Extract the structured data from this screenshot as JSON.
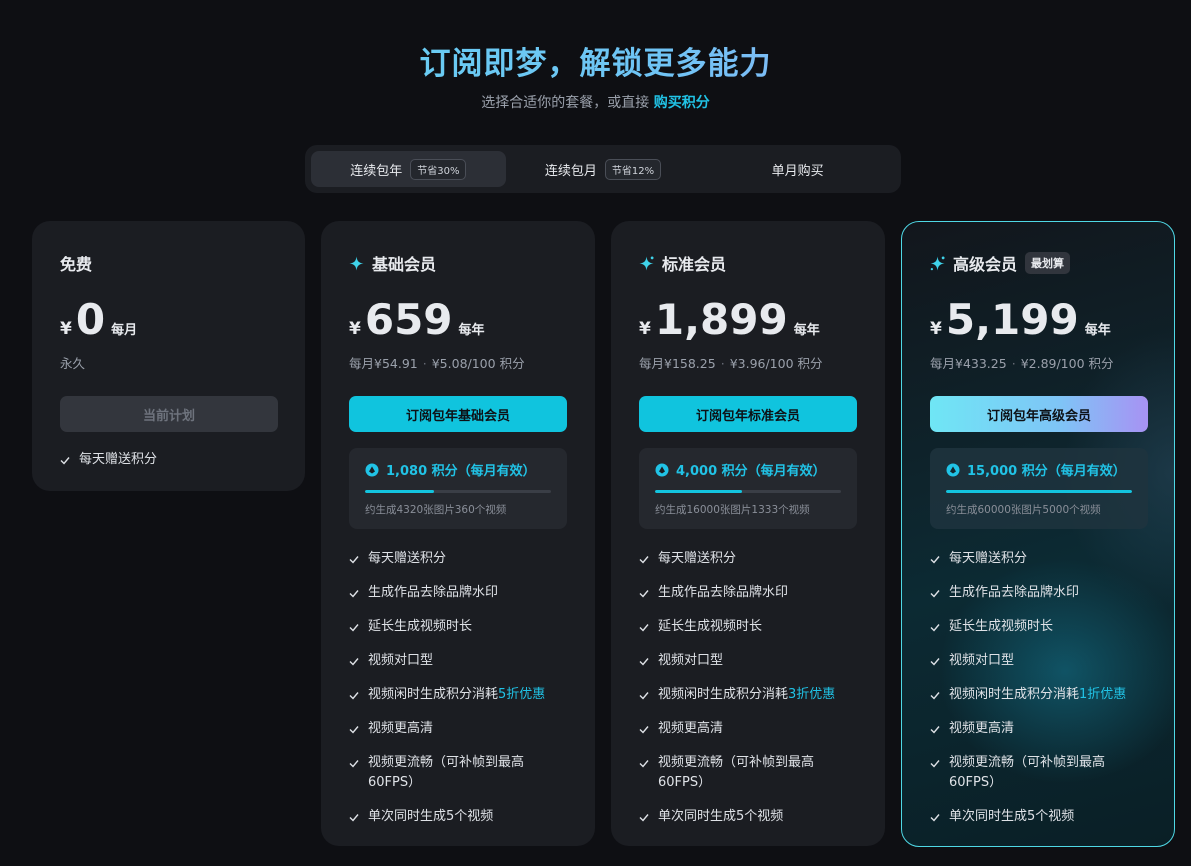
{
  "header": {
    "title": "订阅即梦，解锁更多能力",
    "subtitle_prefix": "选择合适你的套餐，或直接",
    "subtitle_link": "购买积分"
  },
  "tabs": [
    {
      "label": "连续包年",
      "badge": "节省30%",
      "active": true
    },
    {
      "label": "连续包月",
      "badge": "节省12%",
      "active": false
    },
    {
      "label": "单月购买",
      "badge": "",
      "active": false
    }
  ],
  "plans": {
    "free": {
      "name": "免费",
      "currency": "¥",
      "amount": "0",
      "period": "每月",
      "note": "永久",
      "cta": "当前计划",
      "features": [
        "每天赠送积分"
      ]
    },
    "basic": {
      "name": "基础会员",
      "currency": "¥",
      "amount": "659",
      "period": "每年",
      "monthly": "每月¥54.91",
      "per_credit": "¥5.08/100 积分",
      "cta": "订阅包年基础会员",
      "credits": "1,080 积分（每月有效）",
      "credit_level": 0.37,
      "credit_note": "约生成4320张图片360个视频",
      "features": [
        "每天赠送积分",
        "生成作品去除品牌水印",
        "延长生成视频时长",
        "视频对口型"
      ],
      "idle_prefix": "视频闲时生成积分消耗",
      "idle_highlight": "5折优惠",
      "more_features": [
        "视频更高清",
        "视频更流畅（可补帧到最高60FPS）",
        "单次同时生成5个视频"
      ]
    },
    "standard": {
      "name": "标准会员",
      "currency": "¥",
      "amount": "1,899",
      "period": "每年",
      "monthly": "每月¥158.25",
      "per_credit": "¥3.96/100 积分",
      "cta": "订阅包年标准会员",
      "credits": "4,000 积分（每月有效）",
      "credit_level": 0.47,
      "credit_note": "约生成16000张图片1333个视频",
      "features": [
        "每天赠送积分",
        "生成作品去除品牌水印",
        "延长生成视频时长",
        "视频对口型"
      ],
      "idle_prefix": "视频闲时生成积分消耗",
      "idle_highlight": "3折优惠",
      "more_features": [
        "视频更高清",
        "视频更流畅（可补帧到最高60FPS）",
        "单次同时生成5个视频"
      ]
    },
    "premium": {
      "name": "高级会员",
      "badge": "最划算",
      "currency": "¥",
      "amount": "5,199",
      "period": "每年",
      "monthly": "每月¥433.25",
      "per_credit": "¥2.89/100 积分",
      "cta": "订阅包年高级会员",
      "credits": "15,000 积分（每月有效）",
      "credit_level": 1.0,
      "credit_note": "约生成60000张图片5000个视频",
      "features": [
        "每天赠送积分",
        "生成作品去除品牌水印",
        "延长生成视频时长",
        "视频对口型"
      ],
      "idle_prefix": "视频闲时生成积分消耗",
      "idle_highlight": "1折优惠",
      "more_features": [
        "视频更高清",
        "视频更流畅（可补帧到最高60FPS）",
        "单次同时生成5个视频"
      ]
    }
  },
  "icons": {
    "plan_icon": "sparkle-icon",
    "credit_icon": "coin-icon",
    "feature_icon": "check-icon"
  },
  "colors": {
    "accent": "#21c3e6",
    "cta": "#10c4de",
    "background": "#0e0f13",
    "card": "#1b1d22",
    "premium_border": "#4fd8e5"
  }
}
